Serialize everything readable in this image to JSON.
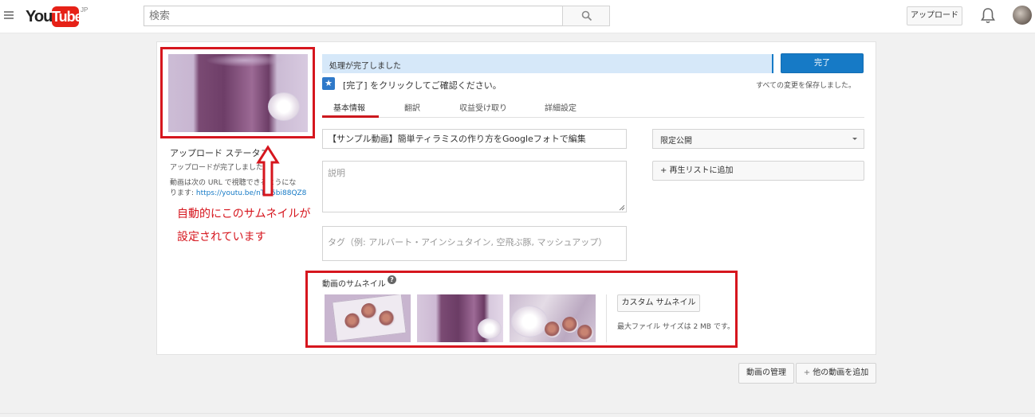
{
  "header": {
    "logo_you": "You",
    "logo_tube": "Tube",
    "logo_region": "JP",
    "search_placeholder": "検索",
    "upload_label": "アップロード"
  },
  "sidebar": {
    "upload_status_title": "アップロード ステータス",
    "upload_complete": "アップロードが完了しました",
    "url_text_line1": "動画は次の URL で視聴できるようにな",
    "url_text_line2_prefix": "ります: ",
    "video_url": "https://youtu.be/nTM5bi88QZ8"
  },
  "annotation": {
    "line1": "自動的にこのサムネイルが",
    "line2": "設定されています",
    "color": "#d6161e"
  },
  "status": {
    "progress_text": "処理が完了しました",
    "done_button": "完了",
    "instruction": "[完了] をクリックしてご確認ください。",
    "saved_text": "すべての変更を保存しました。"
  },
  "tabs": [
    {
      "label": "基本情報",
      "active": true
    },
    {
      "label": "翻訳",
      "active": false
    },
    {
      "label": "収益受け取り",
      "active": false
    },
    {
      "label": "詳細設定",
      "active": false
    }
  ],
  "form": {
    "title_value": "【サンプル動画】簡単ティラミスの作り方をGoogleフォトで編集",
    "description_placeholder": "説明",
    "tags_placeholder": "タグ（例: アルバート・アインシュタイン, 空飛ぶ豚, マッシュアップ）",
    "privacy_selected": "限定公開",
    "add_to_playlist": "+ 再生リストに追加"
  },
  "thumbnails": {
    "section_title": "動画のサムネイル",
    "custom_button": "カスタム サムネイル",
    "max_size_text": "最大ファイル サイズは 2 MB です。"
  },
  "footer_buttons": {
    "manage": "動画の管理",
    "add_more": "他の動画を追加"
  },
  "colors": {
    "accent_blue": "#167ac6",
    "brand_red": "#e62117",
    "progress_bg": "#d6e8f9"
  }
}
